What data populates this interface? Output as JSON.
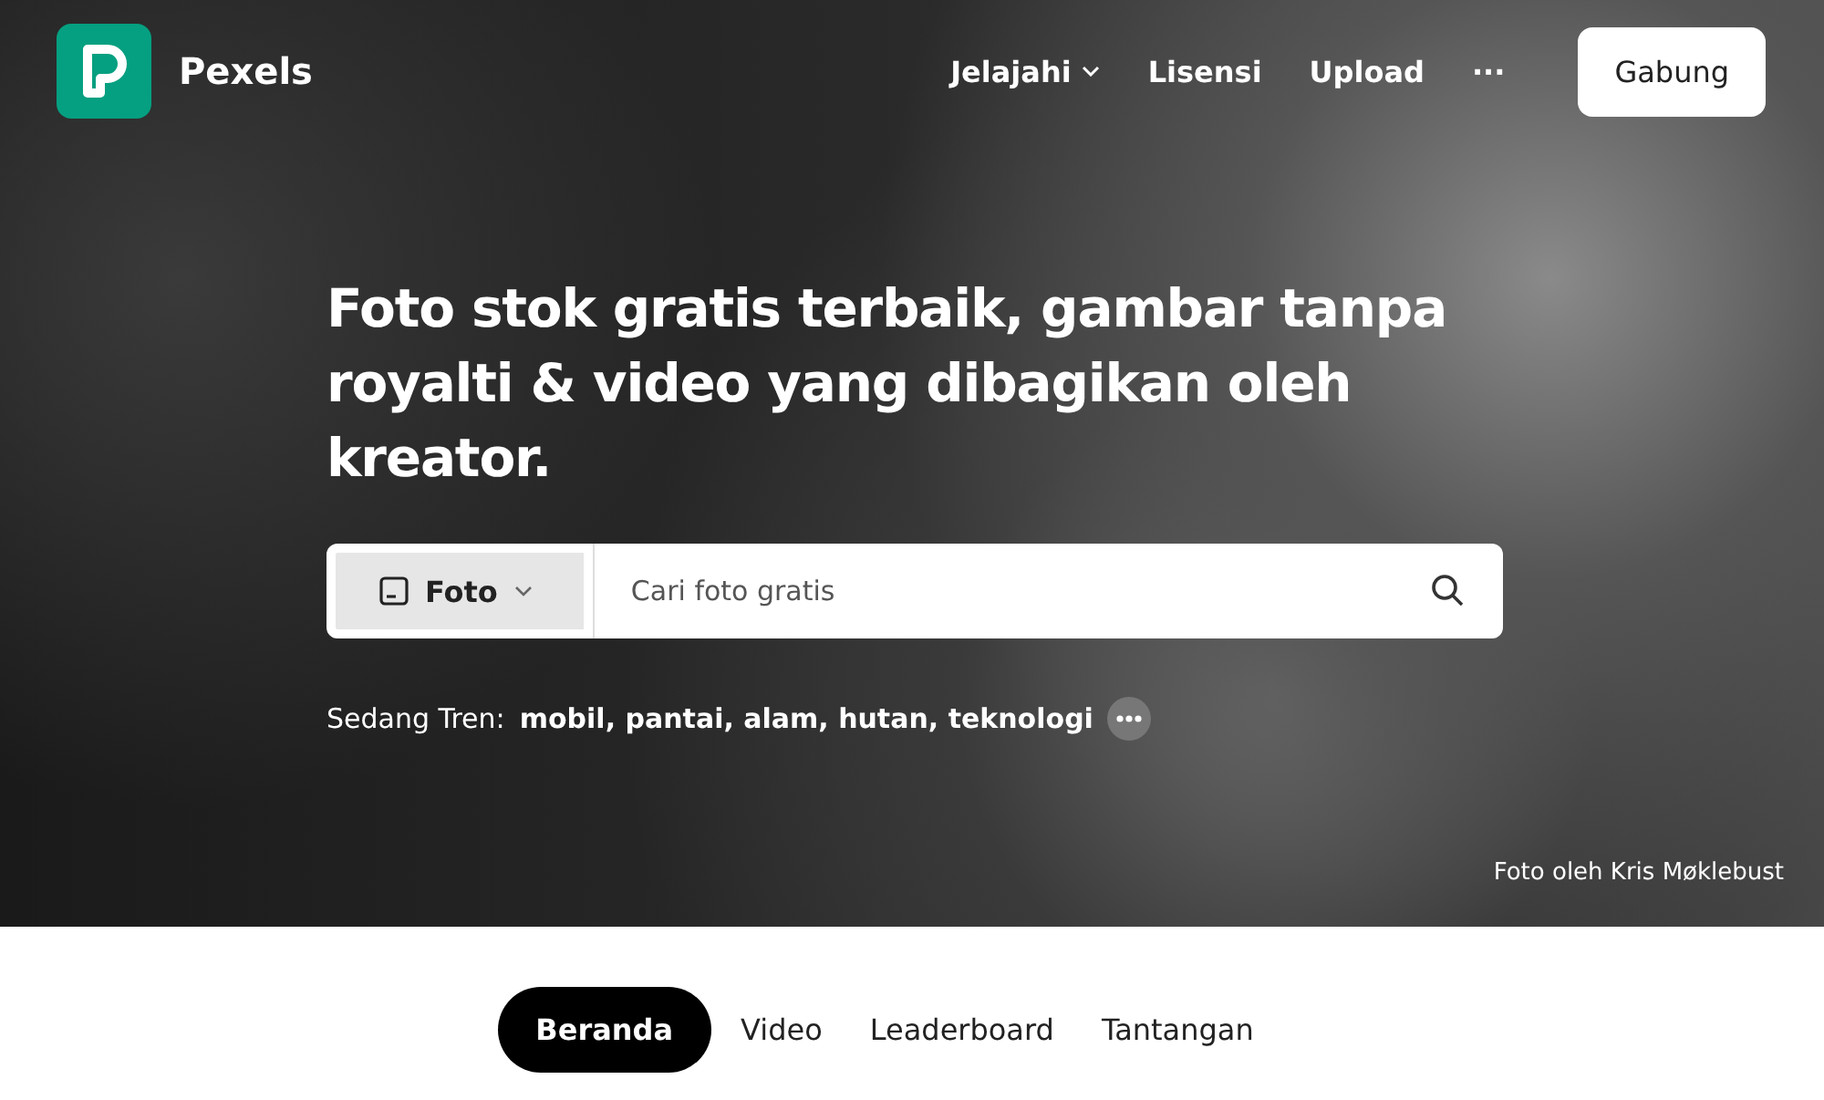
{
  "brand": {
    "name": "Pexels"
  },
  "nav": [
    {
      "label": "Jelajahi",
      "dropdown": true
    },
    {
      "label": "Lisensi",
      "dropdown": false
    },
    {
      "label": "Upload",
      "dropdown": false
    },
    {
      "label": "···",
      "dropdown": false
    }
  ],
  "join_button": "Gabung",
  "headline": "Foto stok gratis terbaik, gambar tanpa royalti & video yang dibagikan oleh kreator.",
  "search": {
    "type_label": "Foto",
    "placeholder": "Cari foto gratis"
  },
  "trending": {
    "label": "Sedang Tren:",
    "terms": "mobil, pantai, alam, hutan, teknologi"
  },
  "photo_credit": "Foto oleh Kris Møklebust",
  "tabs": [
    {
      "label": "Beranda",
      "selected": true
    },
    {
      "label": "Video",
      "selected": false
    },
    {
      "label": "Leaderboard",
      "selected": false
    },
    {
      "label": "Tantangan",
      "selected": false
    }
  ]
}
